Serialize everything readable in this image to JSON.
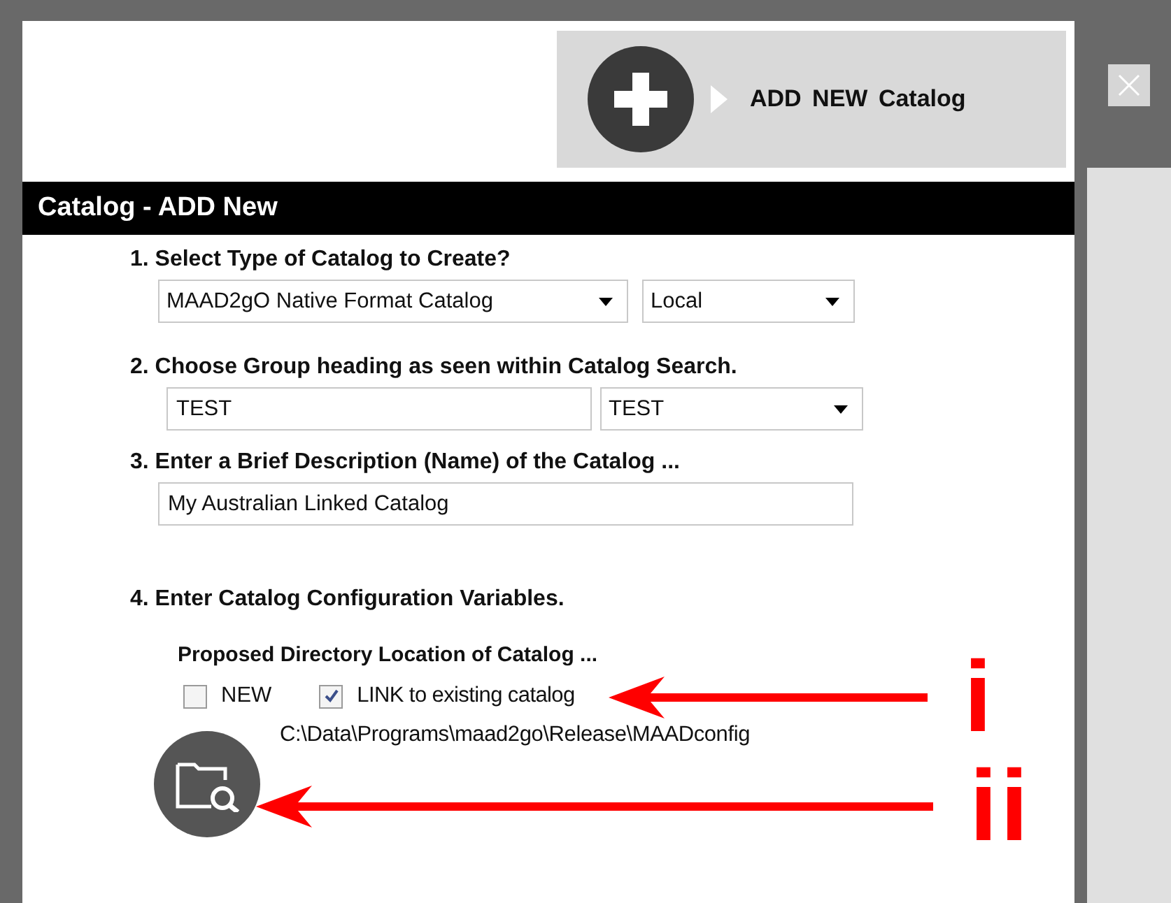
{
  "add_button": {
    "label": "ADD NEW Catalog"
  },
  "header": {
    "title": "Catalog - ADD New"
  },
  "steps": [
    {
      "kind": "selects",
      "label": "1. Select Type of Catalog to Create?",
      "controls": [
        {
          "kind": "dropdown",
          "value": "MAAD2gO Native Format Catalog"
        },
        {
          "kind": "dropdown",
          "value": "Local"
        }
      ]
    },
    {
      "kind": "selects",
      "label": "2. Choose Group heading as seen within Catalog Search.",
      "controls": [
        {
          "kind": "text",
          "value": "TEST"
        },
        {
          "kind": "dropdown",
          "value": "TEST"
        }
      ]
    },
    {
      "kind": "selects",
      "label": "3. Enter a Brief Description (Name) of the Catalog ...",
      "controls": [
        {
          "kind": "text",
          "value": "My Australian Linked Catalog"
        }
      ]
    },
    {
      "kind": "config",
      "label": "4. Enter Catalog Configuration Variables."
    }
  ],
  "directory": {
    "label": "Proposed Directory Location of Catalog ...",
    "options": [
      {
        "label": "NEW",
        "checked": false
      },
      {
        "label": "LINK to existing catalog",
        "checked": true
      }
    ],
    "path": "C:\\Data\\Programs\\maad2go\\Release\\MAADconfig"
  },
  "annotations": [
    {
      "label": "i"
    },
    {
      "label": "ii"
    }
  ]
}
